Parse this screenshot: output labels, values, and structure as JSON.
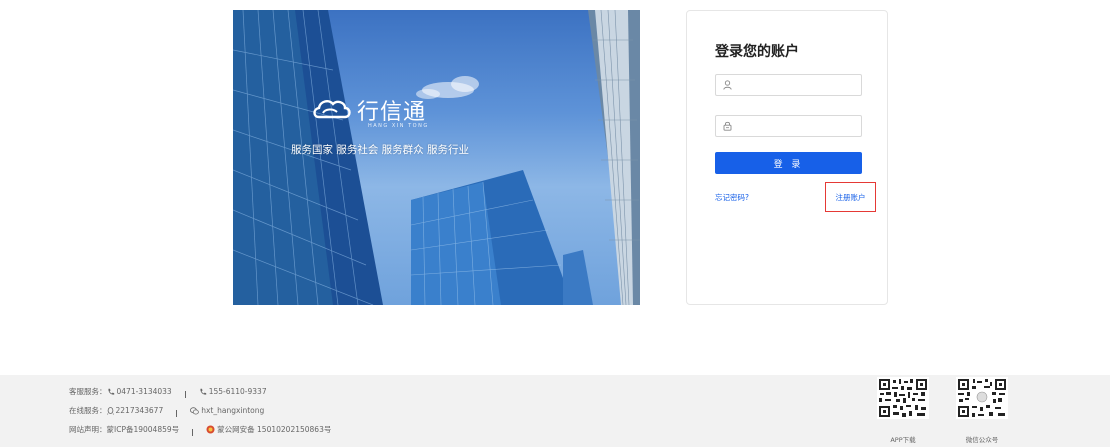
{
  "banner": {
    "brand_name": "行信通",
    "brand_pinyin": "HANG XIN TONG",
    "slogan": "服务国家 服务社会 服务群众 服务行业"
  },
  "login": {
    "title": "登录您的账户",
    "username_placeholder": "",
    "password_placeholder": "",
    "login_button": "登 录",
    "forgot_link": "忘记密码?",
    "register_link": "注册账户"
  },
  "footer": {
    "service_label": "客服服务：",
    "phone1": "0471-3134033",
    "phone2": "155-6110-9337",
    "online_label": "在线服务：",
    "qq": "2217343677",
    "wechat": "hxt_hangxintong",
    "statement_label": "网站声明：",
    "icp": "蒙ICP备19004859号",
    "police": "蒙公网安备 15010202150863号",
    "app_download": "APP下载",
    "wechat_official": "微信公众号"
  },
  "colors": {
    "primary": "#1760e8",
    "highlight_border": "#e53935",
    "footer_bg": "#f2f2f2"
  }
}
